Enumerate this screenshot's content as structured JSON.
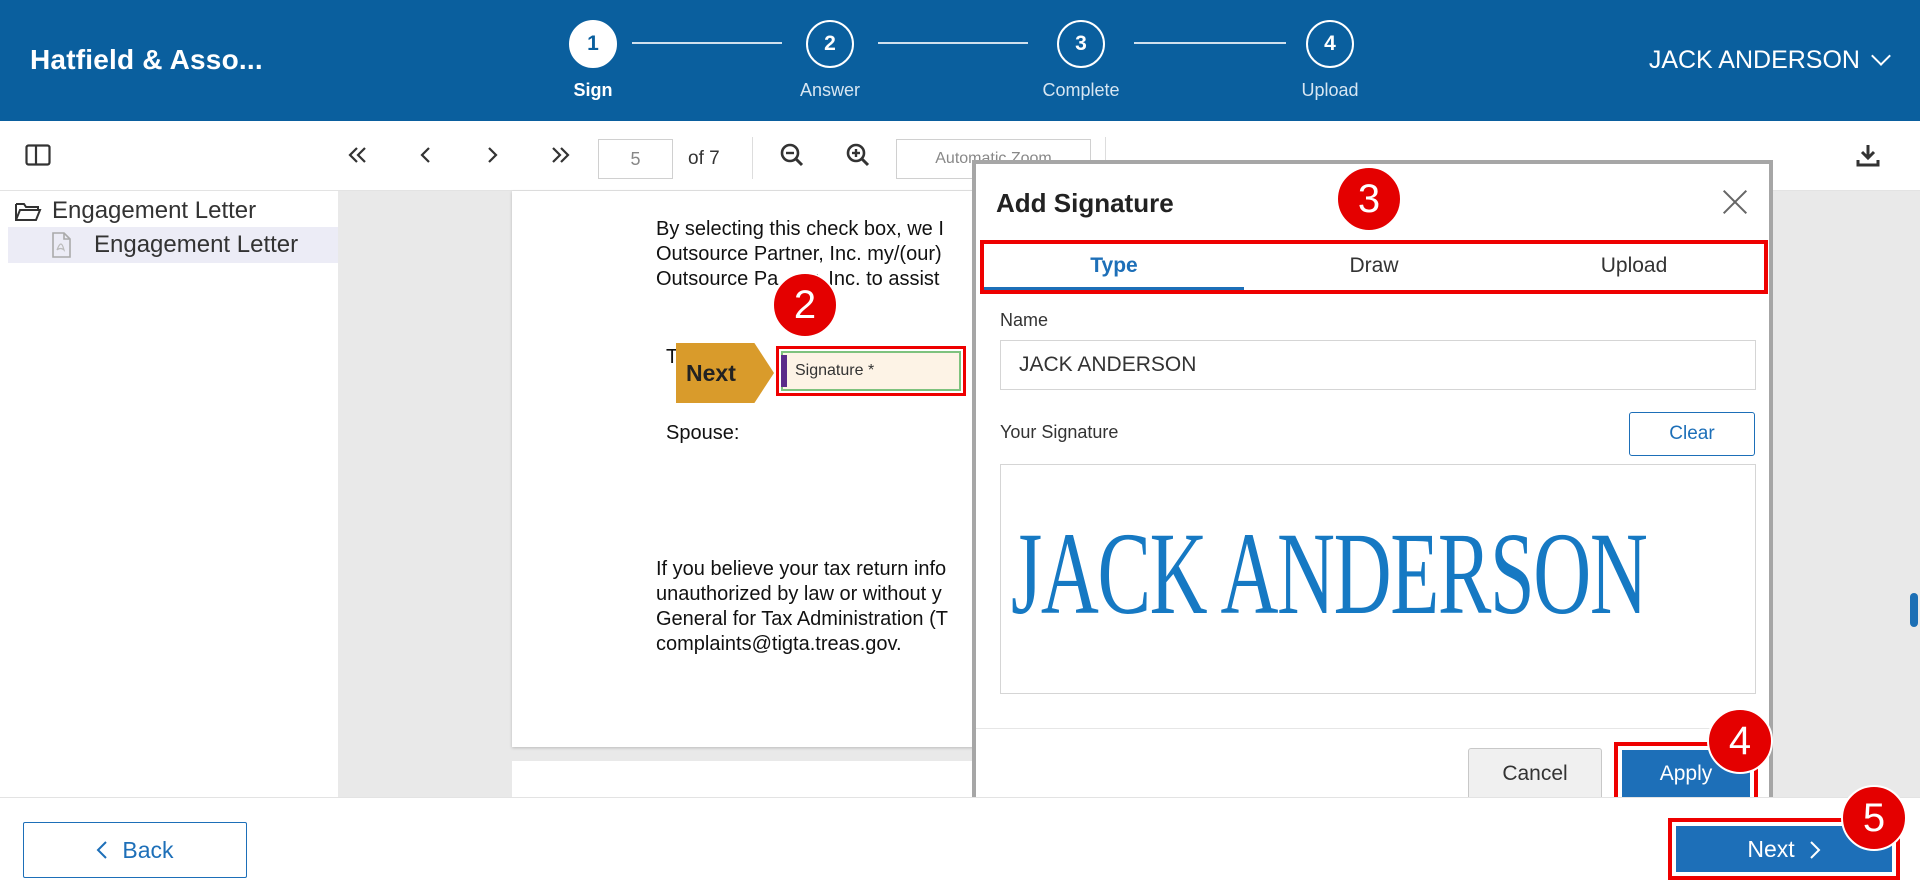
{
  "header": {
    "brand": "Hatfield & Asso...",
    "user": "JACK ANDERSON",
    "steps": [
      {
        "num": "1",
        "label": "Sign",
        "active": true
      },
      {
        "num": "2",
        "label": "Answer"
      },
      {
        "num": "3",
        "label": "Complete"
      },
      {
        "num": "4",
        "label": "Upload"
      }
    ]
  },
  "toolbar": {
    "page_current": "5",
    "page_of": "of 7",
    "zoom_placeholder": "Automatic Zoom",
    "icons": [
      "sidebar-toggle-icon",
      "first-page-icon",
      "prev-page-icon",
      "next-page-icon",
      "last-page-icon",
      "zoom-out-icon",
      "zoom-in-icon",
      "download-icon"
    ]
  },
  "sidebar": {
    "root_label": "Engagement Letter",
    "child_label": "Engagement Letter"
  },
  "document": {
    "para1": "By selecting this check box, we I\nOutsource Partner, Inc. my/(our)\nOutsource Pa      r, Inc. to assist",
    "taxpayer_prefix": "T",
    "spouse_label": "Spouse:",
    "para2": "If you believe your tax return info\nunauthorized by law or without y\nGeneral for Tax Administration (T\ncomplaints@tigta.treas.gov.",
    "signature_field": "Signature *",
    "next_flag": "Next"
  },
  "modal": {
    "title": "Add Signature",
    "tabs": [
      "Type",
      "Draw",
      "Upload"
    ],
    "active_tab": "Type",
    "name_label": "Name",
    "name_value": "JACK ANDERSON",
    "signature_label": "Your Signature",
    "clear_label": "Clear",
    "signature_render": "JACK ANDERSON",
    "cancel_label": "Cancel",
    "apply_label": "Apply"
  },
  "footer": {
    "back_label": "Back",
    "next_label": "Next"
  },
  "callouts": [
    "2",
    "3",
    "4",
    "5"
  ],
  "colors": {
    "primary": "#0a5f9e",
    "button_blue": "#1d6fb8",
    "callout_red": "#e40000",
    "next_flag": "#d99b2b"
  }
}
